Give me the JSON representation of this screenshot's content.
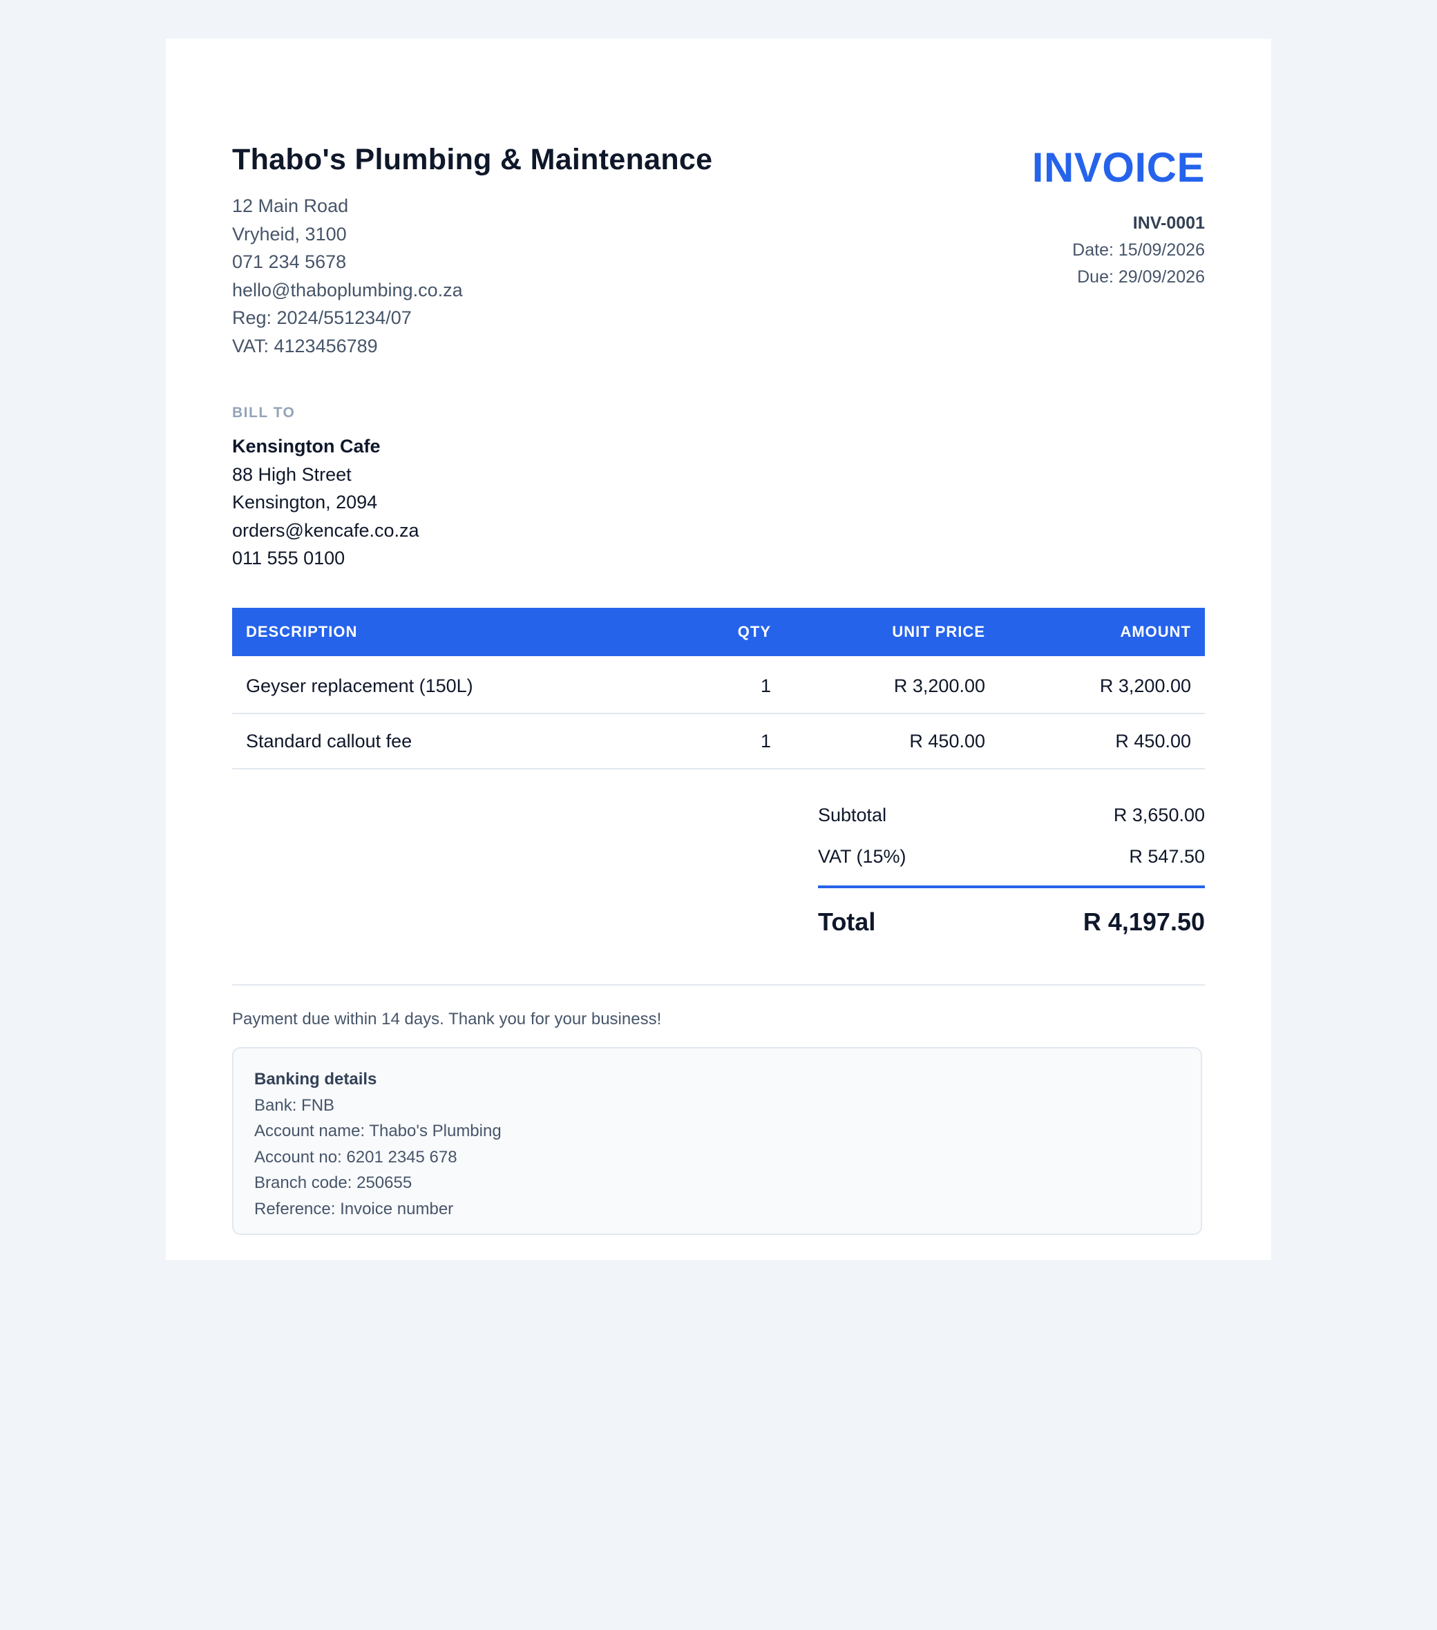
{
  "business": {
    "name": "Thabo's Plumbing & Maintenance",
    "address_line1": "12 Main Road",
    "address_line2": "Vryheid, 3100",
    "phone": "071 234 5678",
    "email": "hello@thaboplumbing.co.za",
    "reg": "Reg: 2024/551234/07",
    "vat": "VAT: 4123456789"
  },
  "invoice": {
    "title": "INVOICE",
    "number": "INV-0001",
    "date": "Date: 15/09/2026",
    "due": "Due: 29/09/2026"
  },
  "bill_to": {
    "heading": "BILL TO",
    "client": "Kensington Cafe",
    "address_line1": "88 High Street",
    "address_line2": "Kensington, 2094",
    "email": "orders@kencafe.co.za",
    "phone": "011 555 0100"
  },
  "table": {
    "headers": [
      "DESCRIPTION",
      "QTY",
      "UNIT PRICE",
      "AMOUNT"
    ],
    "rows": [
      {
        "description": "Geyser replacement (150L)",
        "qty": "1",
        "unit_price": "R 3,200.00",
        "amount": "R 3,200.00"
      },
      {
        "description": "Standard callout fee",
        "qty": "1",
        "unit_price": "R 450.00",
        "amount": "R 450.00"
      }
    ]
  },
  "totals": {
    "subtotal_label": "Subtotal",
    "subtotal": "R 3,650.00",
    "vat_label": "VAT (15%)",
    "vat": "R 547.50",
    "total_label": "Total",
    "total": "R 4,197.50"
  },
  "terms": "Payment due within 14 days. Thank you for your business!",
  "banking": {
    "title": "Banking details",
    "bank": "Bank: FNB",
    "account_name": "Account name: Thabo's Plumbing",
    "account_no": "Account no: 6201 2345 678",
    "branch_code": "Branch code: 250655",
    "reference": "Reference: Invoice number"
  },
  "colors": {
    "accent": "#2563eb",
    "background": "#f1f5f9",
    "text": "#0f172a",
    "muted": "#475569"
  }
}
